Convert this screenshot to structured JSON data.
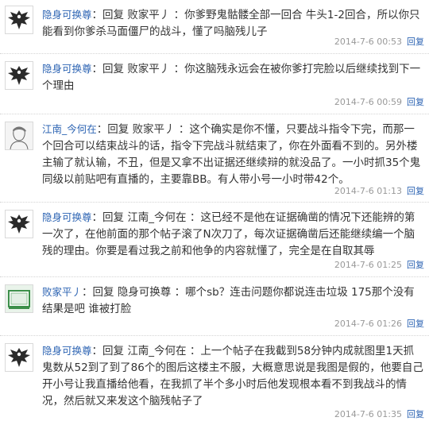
{
  "replies": [
    {
      "avatar": "eagle-emblem",
      "username": "隐身可换尊",
      "reply_word": "回复",
      "target": "败家平丿",
      "text": "你爹野鬼骷髅全部一回合 牛头1-2回合，所以你只能看到你爹杀马面僵尸的战斗，懂了吗脑残儿子",
      "time": "2014-7-6 00:53",
      "reply_label": "回复"
    },
    {
      "avatar": "eagle-emblem",
      "username": "隐身可换尊",
      "reply_word": "回复",
      "target": "败家平丿",
      "text": "你这脑残永远会在被你爹打完脸以后继续找到下一个理由",
      "time": "2014-7-6 00:59",
      "reply_label": "回复"
    },
    {
      "avatar": "sketch-portrait",
      "username": "江南_今何在",
      "reply_word": "回复",
      "target": "败家平丿",
      "text": "这个确实是你不懂，只要战斗指令下完，而那一个回合可以结束战斗的话，指令下完战斗就结束了，你在外面看不到的。另外楼主输了就认输，不丑，但是又拿不出证据还继续辩的就没品了。一小时抓35个鬼同级以前贴吧有直播的，主要靠BB。有人带小号一小时带42个。",
      "time": "2014-7-6 01:13",
      "reply_label": "回复"
    },
    {
      "avatar": "eagle-emblem",
      "username": "隐身可换尊",
      "reply_word": "回复",
      "target": "江南_今何在",
      "text": "这已经不是他在证据确凿的情况下还能辨的第一次了，在他前面的那个帖子滚了N次刀了，每次证据确凿后还能继续编一个脑残的理由。你要是看过我之前和他争的内容就懂了，完全是在自取其辱",
      "time": "2014-7-6 01:25",
      "reply_label": "回复"
    },
    {
      "avatar": "green-frame",
      "username": "败家平丿",
      "reply_word": "回复",
      "target": "隐身可换尊",
      "text": "哪个sb？连击问题你都说连击垃圾 175那个没有结果是吧 谁被打脸",
      "time": "2014-7-6 01:26",
      "reply_label": "回复"
    },
    {
      "avatar": "eagle-emblem",
      "username": "隐身可换尊",
      "reply_word": "回复",
      "target": "江南_今何在",
      "text": "上一个帖子在我截到58分钟内成就图里1天抓鬼数从52到了到了86个的图后这楼主不服，大概意思说是我图是假的，他要自己开小号让我直播给他看，在我抓了半个多小时后他发现根本看不到我战斗的情况，然后就又来发这个脑残帖子了",
      "time": "2014-7-6 01:35",
      "reply_label": "回复"
    }
  ]
}
